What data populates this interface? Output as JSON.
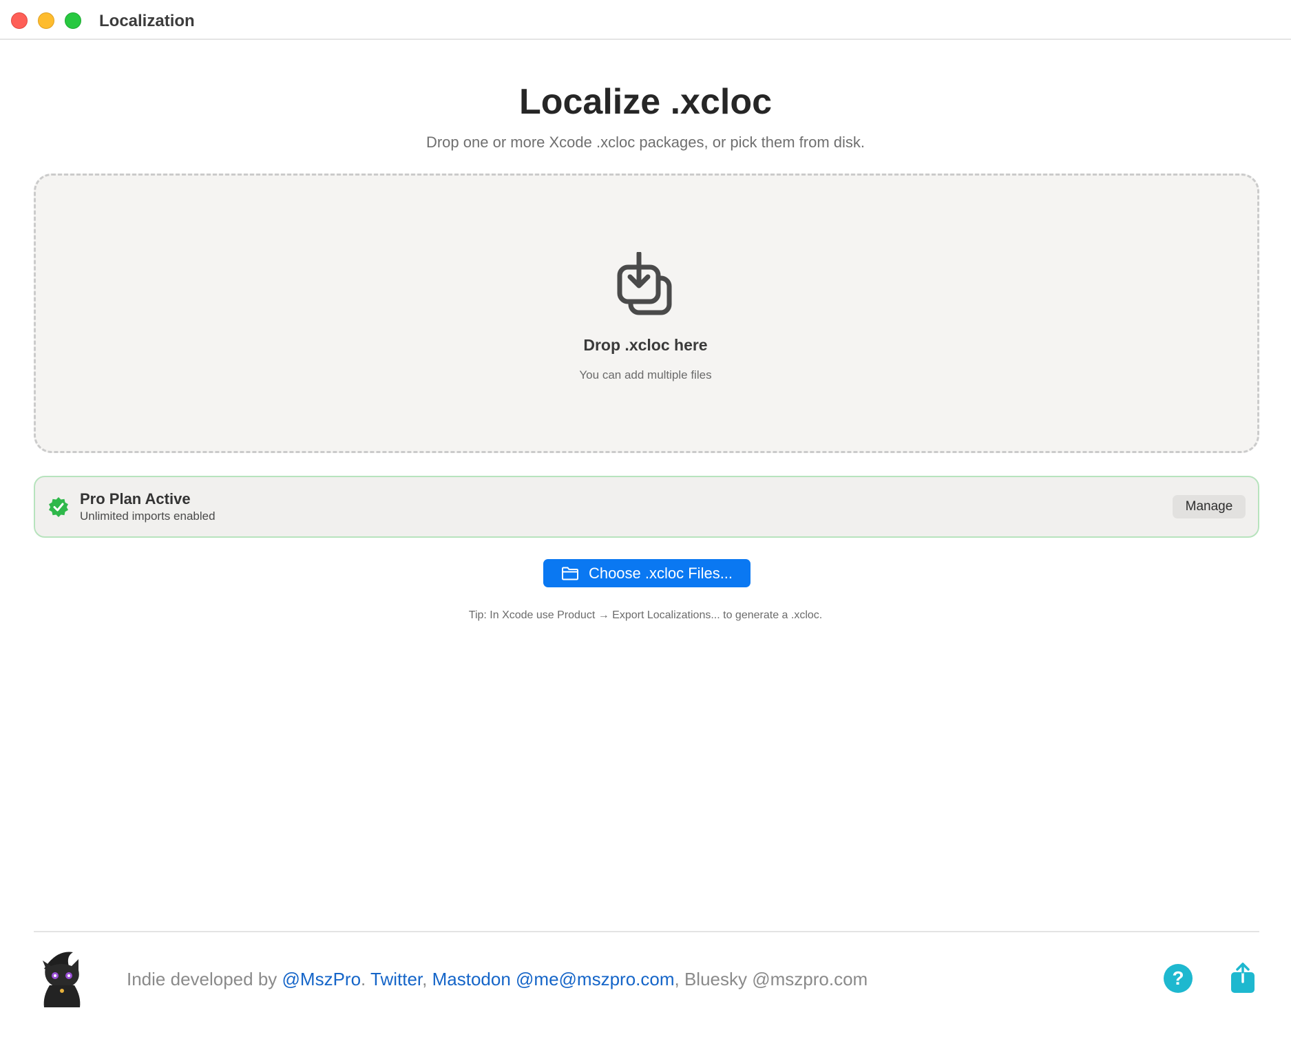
{
  "window": {
    "title": "Localization"
  },
  "header": {
    "title": "Localize .xcloc",
    "subtitle": "Drop one or more Xcode .xcloc packages, or pick them from disk."
  },
  "drop_zone": {
    "icon": "tray-arrow-down-icon",
    "title": "Drop .xcloc here",
    "hint": "You can add multiple files"
  },
  "plan": {
    "icon": "checkmark-seal-icon",
    "title": "Pro Plan Active",
    "subtitle": "Unlimited imports enabled",
    "manage_label": "Manage"
  },
  "actions": {
    "choose_icon": "folder-icon",
    "choose_label": "Choose .xcloc Files...",
    "tip": "Tip: In Xcode use Product → Export Localizations... to generate a .xcloc."
  },
  "footer": {
    "prefix": "Indie developed by ",
    "handle": "@MszPro",
    "sep1": ". ",
    "twitter": "Twitter",
    "sep2": ", ",
    "mastodon": "Mastodon @me@mszpro.com",
    "sep3": ", Bluesky @mszpro.com",
    "help_label": "?"
  },
  "colors": {
    "accent": "#0a78f2",
    "success": "#2fb84a",
    "link": "#1565c8",
    "help": "#1eb8cf"
  }
}
